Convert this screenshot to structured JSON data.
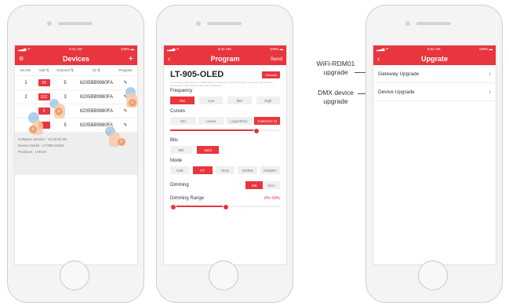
{
  "status": {
    "time": "9:41 AM",
    "battery": "100%"
  },
  "devices_screen": {
    "title": "Devices",
    "columns": [
      "Sn.NO.",
      "Add",
      "Channel",
      "ID",
      "Program"
    ],
    "rows": [
      {
        "no": "1",
        "add": "24",
        "channel": "5",
        "id": "6205BB9980FA"
      },
      {
        "no": "2",
        "add": "512",
        "channel": "3",
        "id": "6205BB9980FA"
      },
      {
        "no": "",
        "add": "5",
        "channel": "",
        "id": "6205BB9980FA"
      },
      {
        "no": "",
        "add": "",
        "channel": "5",
        "id": "6205BB9980FA"
      }
    ],
    "info": [
      "Software Version : V2.00.01.00",
      "Device Model : LT-905-OLED",
      "Producer : LTECH"
    ],
    "markers": [
      "a",
      "b",
      "c",
      "d"
    ]
  },
  "program_screen": {
    "title": "Program",
    "send": "Send",
    "model": "LT-905-OLED",
    "defaults": "Defaults",
    "note": "The working parameters of multiple devices of the same project should be the same, otherwise the consistency of the lighting effects will be affected.",
    "frequency": {
      "label": "Frequency",
      "options": [
        "Std",
        "Low",
        "Mid",
        "High"
      ]
    },
    "curves": {
      "label": "Curves",
      "options": [
        "Std",
        "Linear",
        "Logarithmic",
        "Custom(7.2)"
      ]
    },
    "bits": {
      "label": "Bits",
      "options": [
        "8bit",
        "16bit"
      ]
    },
    "mode": {
      "label": "Mode",
      "options": [
        "DIM",
        "CT",
        "RGB",
        "RGBW",
        "RGBWY"
      ]
    },
    "dimming": {
      "label": "Dimming",
      "options": [
        "Std",
        "Smo"
      ]
    },
    "dimming_range": {
      "label": "Dimming Range",
      "value": "0%~50%"
    }
  },
  "upgrade_screen": {
    "title": "Upgrate",
    "items": [
      "Gateway Upgrade",
      "Device Upgrade"
    ]
  },
  "callouts": {
    "wifi_line1": "WiFi-RDM01",
    "wifi_line2": "upgrade",
    "dmx_line1": "DMX device",
    "dmx_line2": "upgrade"
  },
  "colors": {
    "accent": "#e8353e"
  }
}
